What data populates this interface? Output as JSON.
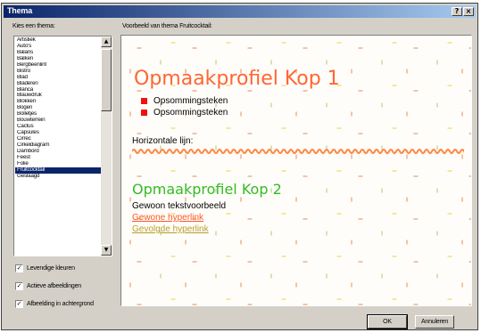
{
  "window": {
    "title": "Thema",
    "help_glyph": "?",
    "close_glyph": "×"
  },
  "theme_list": {
    "label": "Kies een thema:",
    "items": [
      "Artistiek",
      "Auto's",
      "Balans",
      "Balken",
      "Bergbeenlint",
      "Bistro",
      "Blad",
      "Bladeren",
      "Blanca",
      "Blauwdruk",
      "Blokken",
      "Bogen",
      "Bolletjes",
      "Bouwterrein",
      "Cactus",
      "Capsules",
      "Cirrec",
      "Cirkeldiagram",
      "Dambord",
      "Feest",
      "Folie",
      "Fruitcocktail",
      "Geslaagd"
    ],
    "selected": "Fruitcocktail",
    "scroll_up_glyph": "▲",
    "scroll_down_glyph": "▼"
  },
  "checkboxes": [
    {
      "label": "Levendige kleuren",
      "checked": true,
      "glyph": "✓"
    },
    {
      "label": "Actieve afbeeldingen",
      "checked": true,
      "glyph": "✓"
    },
    {
      "label": "Afbeelding in achtergrond",
      "checked": true,
      "glyph": "✓"
    }
  ],
  "preview": {
    "label": "Voorbeeld van thema Fruitcocktail:",
    "heading1": "Opmaakprofiel Kop 1",
    "bullets": [
      "Opsommingsteken",
      "Opsommingsteken"
    ],
    "hr_label": "Horizontale lijn:",
    "heading2": "Opmaakprofiel Kop 2",
    "body_text": "Gewoon tekstvoorbeeld",
    "link": "Gewone hyperlink",
    "visited_link": "Gevolgde hyperlink",
    "colors": {
      "heading1": "#ff6633",
      "heading2": "#33bb22",
      "link": "#ff5522",
      "visited_link": "#b79e2b",
      "bullet": "#ee1111"
    }
  },
  "buttons": {
    "ok": "OK",
    "cancel": "Annuleren"
  }
}
